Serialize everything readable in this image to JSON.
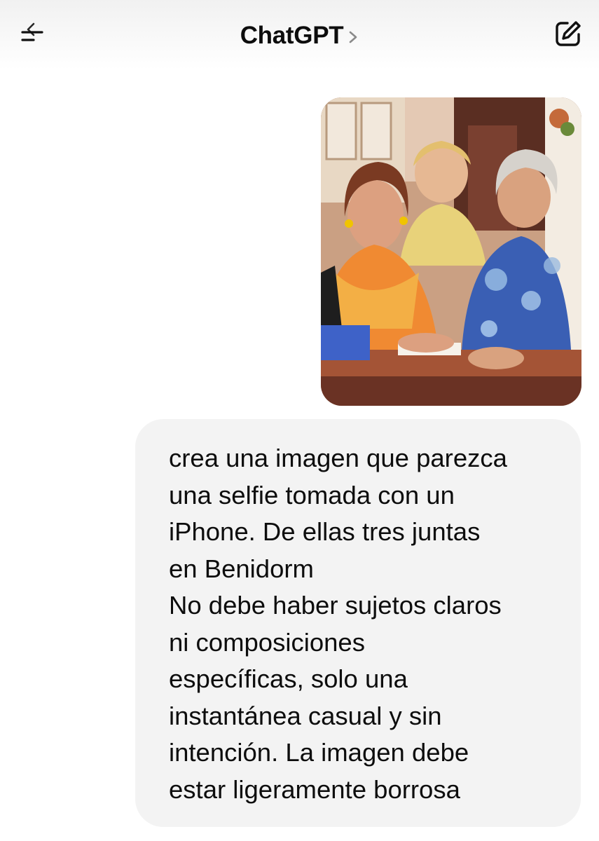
{
  "header": {
    "title": "ChatGPT",
    "menu_icon": "sidebar-menu-icon",
    "title_chevron_icon": "chevron-right-icon",
    "compose_icon": "new-chat-compose-icon"
  },
  "conversation": {
    "user_image": {
      "alt": ""
    },
    "user_message": {
      "text": "crea una imagen que parezca\nuna selfie tomada con un\niPhone. De ellas tres juntas\nen Benidorm\nNo debe haber sujetos claros\nni composiciones\nespecíficas, solo una\ninstantánea casual y sin\nintención. La imagen debe\nestar ligeramente borrosa"
    }
  },
  "colors": {
    "background": "#ffffff",
    "bubble": "#f3f3f3",
    "text": "#0d0d0d"
  }
}
